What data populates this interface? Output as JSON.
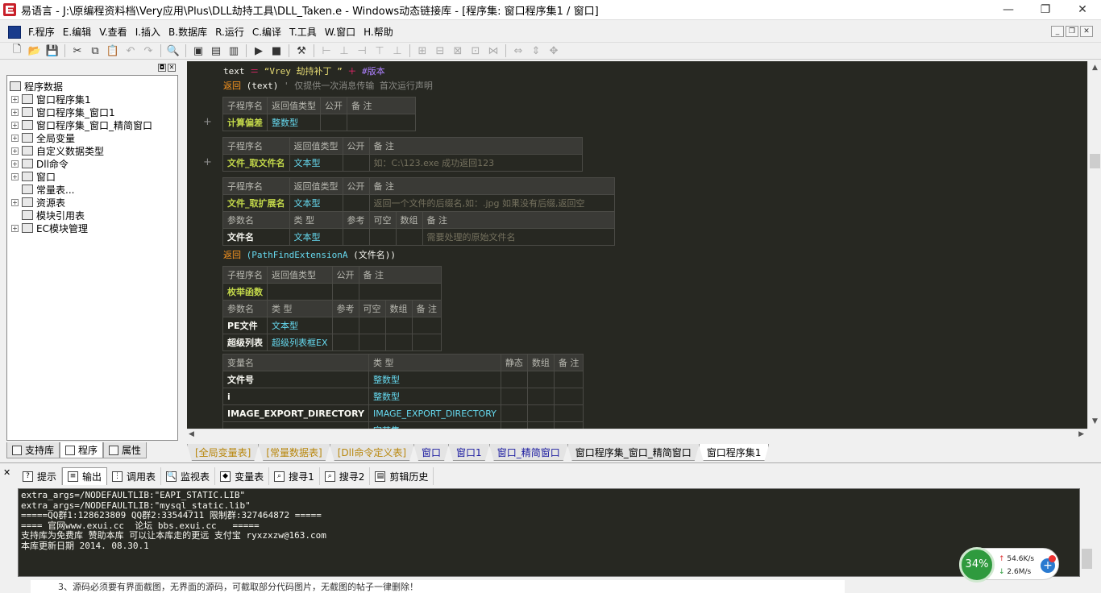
{
  "window": {
    "title": "易语言 - J:\\原编程资料档\\Very应用\\Plus\\DLL劫持工具\\DLL_Taken.e - Windows动态链接库 - [程序集: 窗口程序集1 / 窗口]",
    "min": "—",
    "max": "❐",
    "close": "✕"
  },
  "menu": [
    "F.程序",
    "E.编辑",
    "V.查看",
    "I.插入",
    "B.数据库",
    "R.运行",
    "C.编译",
    "T.工具",
    "W.窗口",
    "H.帮助"
  ],
  "mdi_buttons": [
    "_",
    "❐",
    "✕"
  ],
  "left_panel": {
    "header_buttons": [
      "◘",
      "✕"
    ],
    "tree": [
      {
        "label": "程序数据",
        "level": 0,
        "expand": ""
      },
      {
        "label": "窗口程序集1",
        "level": 1,
        "expand": "+"
      },
      {
        "label": "窗口程序集_窗口1",
        "level": 1,
        "expand": "+"
      },
      {
        "label": "窗口程序集_窗口_精简窗口",
        "level": 1,
        "expand": "+"
      },
      {
        "label": "全局变量",
        "level": 1,
        "expand": "+"
      },
      {
        "label": "自定义数据类型",
        "level": 1,
        "expand": "+"
      },
      {
        "label": "Dll命令",
        "level": 1,
        "expand": "+"
      },
      {
        "label": "窗口",
        "level": 1,
        "expand": "+"
      },
      {
        "label": "常量表...",
        "level": 1,
        "expand": ""
      },
      {
        "label": "资源表",
        "level": 1,
        "expand": "+"
      },
      {
        "label": "模块引用表",
        "level": 1,
        "expand": ""
      },
      {
        "label": "EC模块管理",
        "level": 1,
        "expand": "+"
      }
    ],
    "tabs": [
      "支持库",
      "程序",
      "属性"
    ]
  },
  "editor": {
    "line1": {
      "var": "text",
      "op": "＝",
      "str": "“Vrey 劫持补丁 ”",
      "plus": "＋",
      "const": "#版本"
    },
    "line2": {
      "kw": "返回",
      "arg": "(text)",
      "comment": "' 仅提供一次消息传输 首次运行声明"
    },
    "t1": {
      "headers": [
        "子程序名",
        "返回值类型",
        "公开",
        "备 注"
      ],
      "row": [
        "计算偏差",
        "整数型",
        "",
        ""
      ]
    },
    "t2": {
      "headers": [
        "子程序名",
        "返回值类型",
        "公开",
        "备 注"
      ],
      "row": [
        "文件_取文件名",
        "文本型",
        "",
        "如：C:\\123.exe 成功返回123"
      ]
    },
    "t3": {
      "headers": [
        "子程序名",
        "返回值类型",
        "公开",
        "备 注"
      ],
      "row": [
        "文件_取扩展名",
        "文本型",
        "",
        "返回一个文件的后缀名,如：.jpg  如果没有后缀,返回空"
      ],
      "pheaders": [
        "参数名",
        "类 型",
        "参考",
        "可空",
        "数组",
        "备 注"
      ],
      "prow": [
        "文件名",
        "文本型",
        "",
        "",
        "",
        "需要处理的原始文件名"
      ]
    },
    "line3": {
      "kw": "返回",
      "call": "(PathFindExtensionA",
      "arg": "(文件名))"
    },
    "t4": {
      "headers": [
        "子程序名",
        "返回值类型",
        "公开",
        "备 注"
      ],
      "row": [
        "枚举函数",
        "",
        "",
        ""
      ],
      "pheaders": [
        "参数名",
        "类 型",
        "参考",
        "可空",
        "数组",
        "备 注"
      ],
      "prows": [
        [
          "PE文件",
          "文本型",
          "",
          "",
          "",
          ""
        ],
        [
          "超级列表",
          "超级列表框EX",
          "",
          "",
          "",
          ""
        ]
      ]
    },
    "t5": {
      "headers": [
        "变量名",
        "类 型",
        "静态",
        "数组",
        "备 注"
      ],
      "rows": [
        [
          "文件号",
          "整数型"
        ],
        [
          "i",
          "整数型"
        ],
        [
          "IMAGE_EXPORT_DIRECTORY",
          "IMAGE_EXPORT_DIRECTORY"
        ],
        [
          "",
          "字节集"
        ]
      ]
    },
    "gutter_plus": "+"
  },
  "editor_tabs": [
    {
      "label": "[全局变量表]",
      "style": "gold"
    },
    {
      "label": "[常量数据表]",
      "style": "gold"
    },
    {
      "label": "[Dll命令定义表]",
      "style": "gold"
    },
    {
      "label": "窗口",
      "style": "blue"
    },
    {
      "label": "窗口1",
      "style": "blue"
    },
    {
      "label": "窗口_精简窗口",
      "style": "blue"
    },
    {
      "label": "窗口程序集_窗口_精简窗口",
      "style": "normal"
    },
    {
      "label": "窗口程序集1",
      "style": "active"
    }
  ],
  "bottom_tabs": [
    "提示",
    "输出",
    "调用表",
    "监视表",
    "变量表",
    "搜寻1",
    "搜寻2",
    "剪辑历史"
  ],
  "bottom_close": "✕",
  "output_lines": [
    "extra_args=/NODEFAULTLIB:\"EAPI_STATIC.LIB\"",
    "extra_args=/NODEFAULTLIB:\"mysql_static.lib\"",
    "=====QQ群1:128623809 QQ群2:33544711 限制群:327464872 =====",
    "==== 官网www.exui.cc  论坛 bbs.exui.cc   =====",
    "支持库为免费库 赞助本库 可以让本库走的更远 支付宝 ryxzxzw@163.com",
    "本库更新日期 2014. 08.30.1"
  ],
  "bottom_strip_text": "3、源码必须要有界面截图，无界面的源码，可截取部分代码图片，无截图的帖子一律删除！",
  "net_widget": {
    "percent": "34%",
    "up": "54.6K/s",
    "down": "2.6M/s",
    "up_arrow": "↑",
    "down_arrow": "↓",
    "plus": "+"
  }
}
